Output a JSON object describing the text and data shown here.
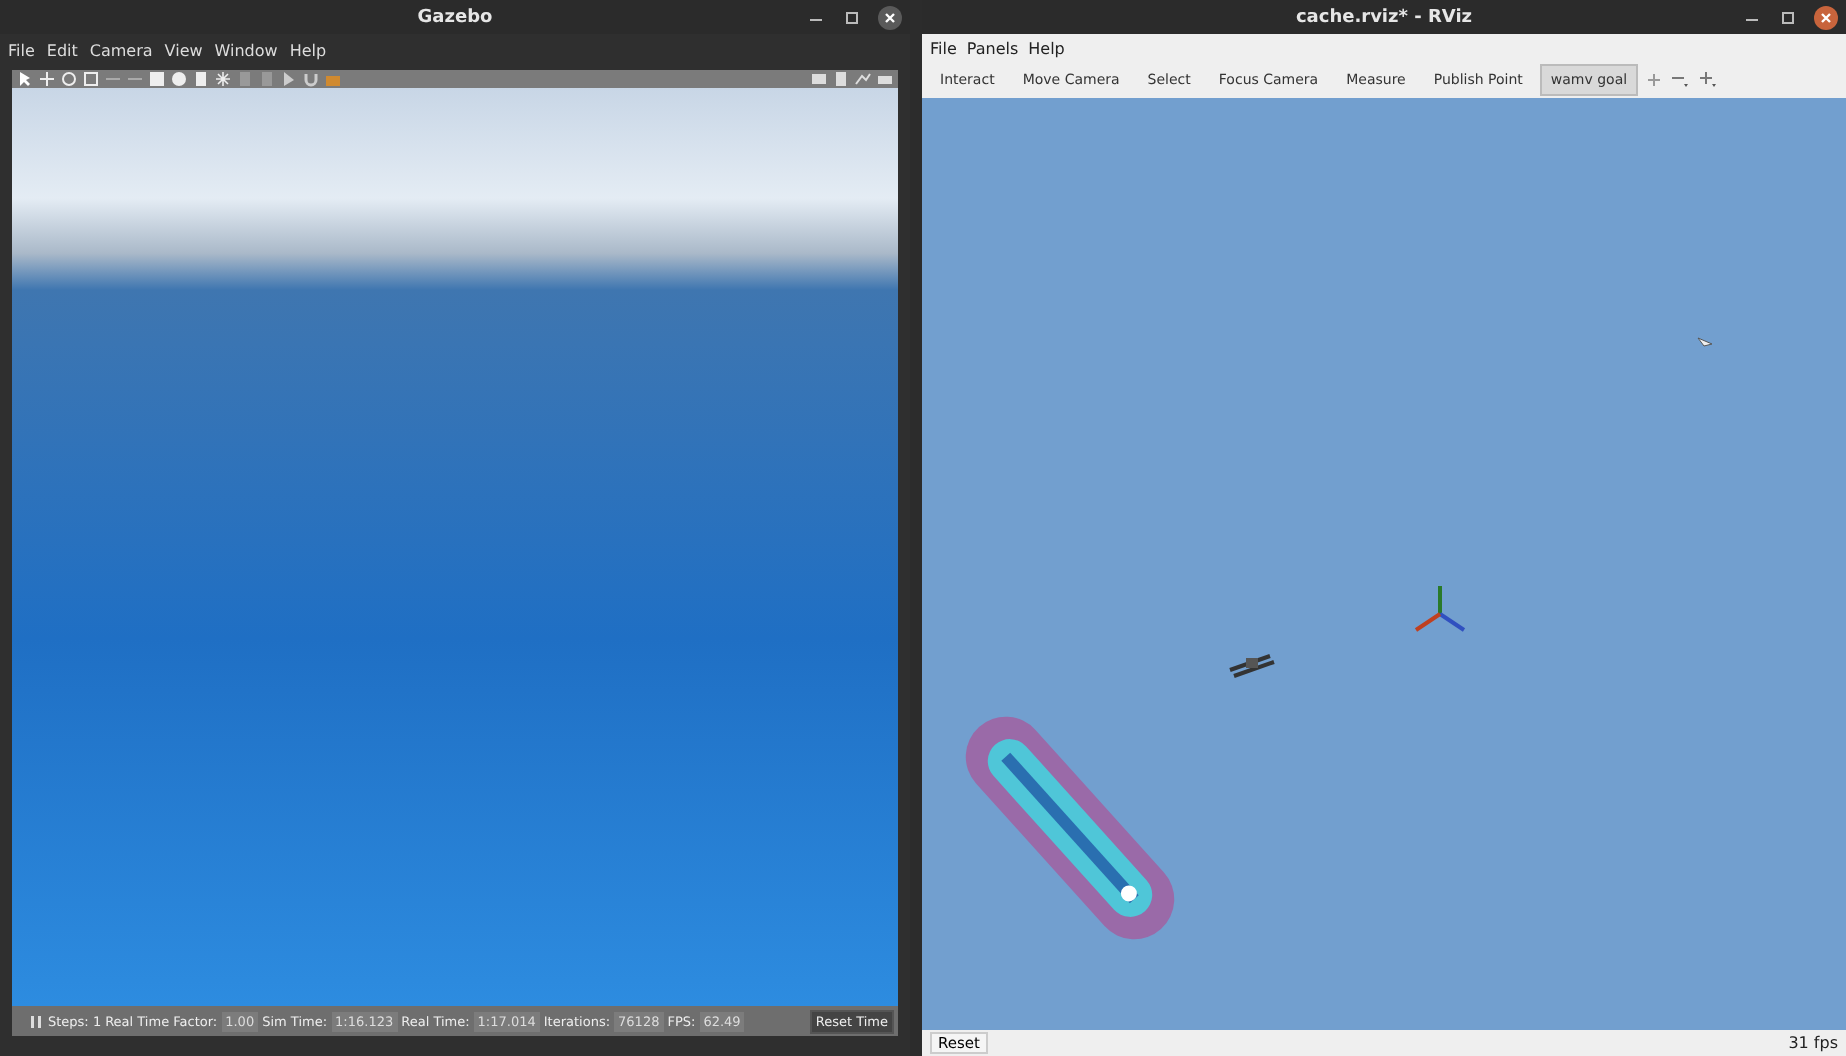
{
  "gazebo": {
    "title": "Gazebo",
    "menu": [
      "File",
      "Edit",
      "Camera",
      "View",
      "Window",
      "Help"
    ],
    "steps": "Steps: 1",
    "fields": [
      {
        "label": "Real Time Factor:",
        "value": "1.00"
      },
      {
        "label": "Sim Time:",
        "value": "1:16.123"
      },
      {
        "label": "Real Time:",
        "value": "1:17.014"
      },
      {
        "label": "Iterations:",
        "value": "76128"
      },
      {
        "label": "FPS:",
        "value": "62.49"
      }
    ],
    "reset_button": "Reset Time"
  },
  "rviz": {
    "title": "cache.rviz* - RViz",
    "menu": [
      "File",
      "Panels",
      "Help"
    ],
    "tools": [
      {
        "label": "Interact",
        "selected": false
      },
      {
        "label": "Move Camera",
        "selected": false
      },
      {
        "label": "Select",
        "selected": false
      },
      {
        "label": "Focus Camera",
        "selected": false
      },
      {
        "label": "Measure",
        "selected": false
      },
      {
        "label": "Publish Point",
        "selected": false
      },
      {
        "label": "wamv goal",
        "selected": true
      }
    ],
    "reset_button": "Reset",
    "fps": "31 fps"
  }
}
